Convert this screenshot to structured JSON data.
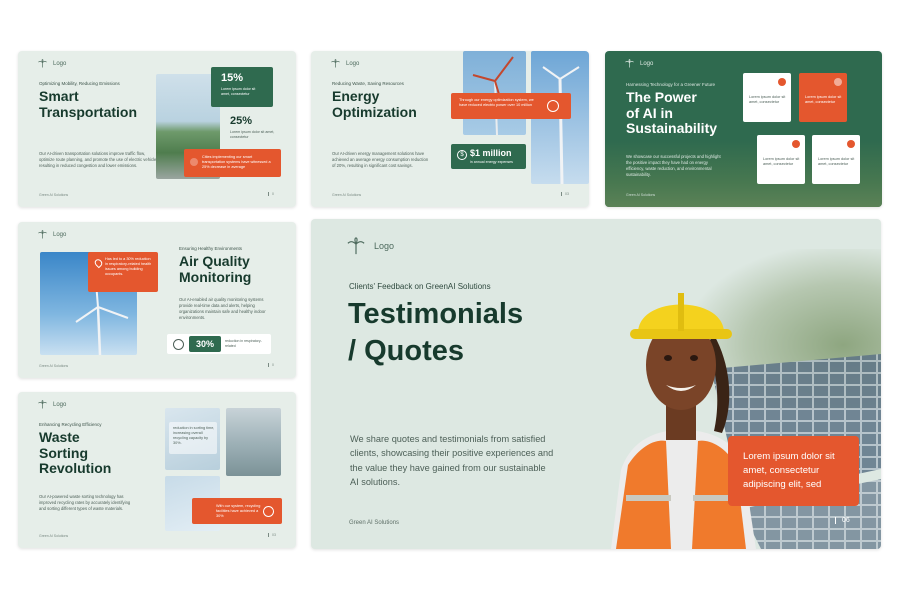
{
  "logo_label": "Logo",
  "footer_brand": "Green AI Solutions",
  "colors": {
    "accent": "#e4572e",
    "primary": "#2f6a4f",
    "background": "#e6eee9",
    "title": "#173a2d"
  },
  "slide1": {
    "subtitle": "Optimizing Mobility, Reducing Emissions",
    "title_line1": "Smart",
    "title_line2": "Transportation",
    "body": "Our AI-driven transportation solutions improve traffic flow, optimize route planning, and promote the use of electric vehicles, resulting in reduced congestion and lower emissions.",
    "stat1_value": "15%",
    "stat1_text": "Lorem ipsum dolor sit amet, consectetur",
    "stat2_value": "25%",
    "stat2_text": "Lorem ipsum dolor sit amet, consectetur",
    "orange_text": "Cities implementing our smart transportation systems have witnessed a 25% decrease in average",
    "page": "0"
  },
  "slide2": {
    "subtitle": "Reducing Waste, Saving Resources",
    "title_line1": "Energy",
    "title_line2": "Optimization",
    "body": "Our AI-driven energy management solutions have achieved an average energy consumption reduction of 20%, resulting in significant cost savings.",
    "orange_text": "Through our energy optimization system, we have reduced electric power over 10 million",
    "stat_value": "$1 million",
    "stat_text": "in annual energy expenses",
    "page": "03"
  },
  "slide3": {
    "subtitle": "Harnessing Technology for a Greener Future",
    "title_line1": "The Power",
    "title_line2": "of AI in",
    "title_line3": "Sustainability",
    "body": "We showcase our successful projects and highlight the positive impact they have had on energy efficiency, waste reduction, and environmental sustainability.",
    "card_text": "Lorem ipsum dolor sit amet, consectetur"
  },
  "slide4": {
    "subtitle": "Ensuring Healthy Environments",
    "title_line1": "Air Quality",
    "title_line2": "Monitoring",
    "body": "Our AI-enabled air quality monitoring systems provide real-time data and alerts, helping organizations maintain safe and healthy indoor environments.",
    "orange_text": "Has led to a 30% reduction in respiratory-related health issues among building occupants.",
    "stat_value": "30%",
    "stat_text": "reduction in respiratory-related",
    "page": "0"
  },
  "slide5": {
    "subtitle": "Enhancing Recycling Efficiency",
    "title_line1": "Waste",
    "title_line2": "Sorting",
    "title_line3": "Revolution",
    "body": "Our AI-powered waste sorting technology has improved recycling rates by accurately identifying and sorting different types of waste materials.",
    "card_text": "reduction in sorting time, increasing overall recycling capacity by 30%.",
    "orange_text": "With our system, recycling facilities have achieved a 30%",
    "page": "03"
  },
  "main": {
    "kicker": "Clients' Feedback on GreenAI Solutions",
    "title_line1": "Testimonials",
    "title_line2": "/ Quotes",
    "body": "We share quotes and testimonials from satisfied clients, showcasing their positive experiences and the value they have gained from our sustainable AI solutions.",
    "quote": "Lorem ipsum dolor sit amet, consectetur adipiscing elit, sed",
    "footer": "Green AI Solutions",
    "page": "06"
  }
}
